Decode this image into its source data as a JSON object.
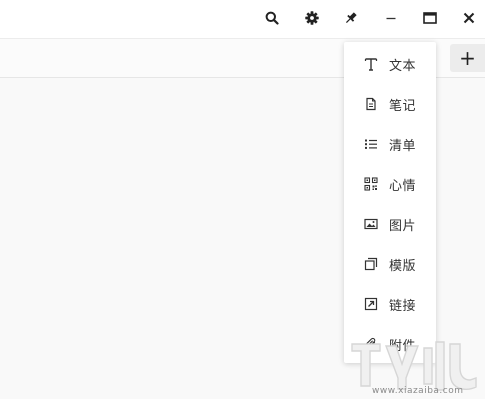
{
  "window": {
    "controls": [
      {
        "name": "search-icon"
      },
      {
        "name": "gear-icon"
      },
      {
        "name": "pin-icon"
      },
      {
        "name": "minimize-icon"
      },
      {
        "name": "maximize-icon"
      },
      {
        "name": "close-icon"
      }
    ]
  },
  "toolbar": {
    "add_label": "+"
  },
  "menu": {
    "items": [
      {
        "label": "文本",
        "icon": "text-icon"
      },
      {
        "label": "笔记",
        "icon": "note-icon"
      },
      {
        "label": "清单",
        "icon": "checklist-icon"
      },
      {
        "label": "心情",
        "icon": "mood-icon"
      },
      {
        "label": "图片",
        "icon": "image-icon"
      },
      {
        "label": "模版",
        "icon": "template-icon"
      },
      {
        "label": "链接",
        "icon": "link-icon"
      },
      {
        "label": "附件",
        "icon": "attachment-icon"
      }
    ]
  },
  "watermark": {
    "sub_text": "www.xiazaiba.com"
  },
  "colors": {
    "background": "#f9f9f9",
    "titlebar": "#ffffff",
    "menu_bg": "#ffffff",
    "text": "#333333",
    "add_button_bg": "#ececec"
  }
}
